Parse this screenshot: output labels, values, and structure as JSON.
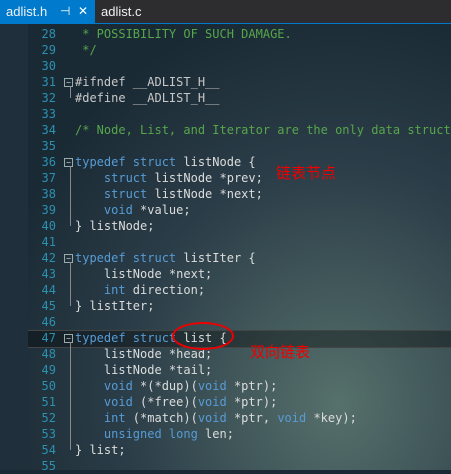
{
  "tabs": [
    {
      "label": "adlist.h",
      "pin": "⊣",
      "close": "✕",
      "active": true
    },
    {
      "label": "adlist.c",
      "active": false
    }
  ],
  "lines": [
    {
      "num": "28",
      "fold": "",
      "parts": [
        {
          "t": " * POSSIBILITY OF SUCH DAMAGE.",
          "c": "cmt"
        }
      ]
    },
    {
      "num": "29",
      "fold": "",
      "parts": [
        {
          "t": " */",
          "c": "cmt"
        }
      ]
    },
    {
      "num": "30",
      "fold": "",
      "parts": []
    },
    {
      "num": "31",
      "fold": "−",
      "parts": [
        {
          "t": "#ifndef __ADLIST_H__",
          "c": "pp"
        }
      ]
    },
    {
      "num": "32",
      "fold": "",
      "parts": [
        {
          "t": "#define __ADLIST_H__",
          "c": "pp"
        }
      ]
    },
    {
      "num": "33",
      "fold": "",
      "parts": []
    },
    {
      "num": "34",
      "fold": "",
      "parts": [
        {
          "t": "/* Node, List, and Iterator are the only data structur",
          "c": "cmt"
        }
      ]
    },
    {
      "num": "35",
      "fold": "",
      "parts": []
    },
    {
      "num": "36",
      "fold": "−",
      "parts": [
        {
          "t": "typedef struct",
          "c": "kw"
        },
        {
          "t": " listNode {",
          "c": "ty"
        }
      ]
    },
    {
      "num": "37",
      "fold": "",
      "parts": [
        {
          "t": "    struct",
          "c": "kw"
        },
        {
          "t": " listNode *prev;",
          "c": "ty"
        }
      ]
    },
    {
      "num": "38",
      "fold": "",
      "parts": [
        {
          "t": "    struct",
          "c": "kw"
        },
        {
          "t": " listNode *next;",
          "c": "ty"
        }
      ]
    },
    {
      "num": "39",
      "fold": "",
      "parts": [
        {
          "t": "    void",
          "c": "kw"
        },
        {
          "t": " *value;",
          "c": "ty"
        }
      ]
    },
    {
      "num": "40",
      "fold": "",
      "parts": [
        {
          "t": "} listNode;",
          "c": "ty"
        }
      ]
    },
    {
      "num": "41",
      "fold": "",
      "parts": []
    },
    {
      "num": "42",
      "fold": "−",
      "parts": [
        {
          "t": "typedef struct",
          "c": "kw"
        },
        {
          "t": " listIter {",
          "c": "ty"
        }
      ]
    },
    {
      "num": "43",
      "fold": "",
      "parts": [
        {
          "t": "    listNode *next;",
          "c": "ty"
        }
      ]
    },
    {
      "num": "44",
      "fold": "",
      "parts": [
        {
          "t": "    int",
          "c": "kw"
        },
        {
          "t": " direction;",
          "c": "ty"
        }
      ]
    },
    {
      "num": "45",
      "fold": "",
      "parts": [
        {
          "t": "} listIter;",
          "c": "ty"
        }
      ]
    },
    {
      "num": "46",
      "fold": "",
      "parts": []
    },
    {
      "num": "47",
      "fold": "−",
      "parts": [
        {
          "t": "typedef struct",
          "c": "kw"
        },
        {
          "t": " list {",
          "c": "ty"
        }
      ],
      "current": true
    },
    {
      "num": "48",
      "fold": "",
      "parts": [
        {
          "t": "    listNode *head;",
          "c": "ty"
        }
      ]
    },
    {
      "num": "49",
      "fold": "",
      "parts": [
        {
          "t": "    listNode *tail;",
          "c": "ty"
        }
      ]
    },
    {
      "num": "50",
      "fold": "",
      "parts": [
        {
          "t": "    void",
          "c": "kw"
        },
        {
          "t": " *(*dup)(",
          "c": "ty"
        },
        {
          "t": "void",
          "c": "kw"
        },
        {
          "t": " *ptr);",
          "c": "ty"
        }
      ]
    },
    {
      "num": "51",
      "fold": "",
      "parts": [
        {
          "t": "    void",
          "c": "kw"
        },
        {
          "t": " (*free)(",
          "c": "ty"
        },
        {
          "t": "void",
          "c": "kw"
        },
        {
          "t": " *ptr);",
          "c": "ty"
        }
      ]
    },
    {
      "num": "52",
      "fold": "",
      "parts": [
        {
          "t": "    int",
          "c": "kw"
        },
        {
          "t": " (*match)(",
          "c": "ty"
        },
        {
          "t": "void",
          "c": "kw"
        },
        {
          "t": " *ptr, ",
          "c": "ty"
        },
        {
          "t": "void",
          "c": "kw"
        },
        {
          "t": " *key);",
          "c": "ty"
        }
      ]
    },
    {
      "num": "53",
      "fold": "",
      "parts": [
        {
          "t": "    unsigned long",
          "c": "kw"
        },
        {
          "t": " len;",
          "c": "ty"
        }
      ]
    },
    {
      "num": "54",
      "fold": "",
      "parts": [
        {
          "t": "} list;",
          "c": "ty"
        }
      ]
    },
    {
      "num": "55",
      "fold": "",
      "parts": []
    }
  ],
  "annotations": {
    "list_node": "链表节点",
    "double_linked_list": "双向链表"
  },
  "colors": {
    "tab_active": "#007acc",
    "comment": "#57a64a",
    "keyword": "#569cd6",
    "line_number": "#2b91af",
    "annotation": "#ee0000"
  }
}
